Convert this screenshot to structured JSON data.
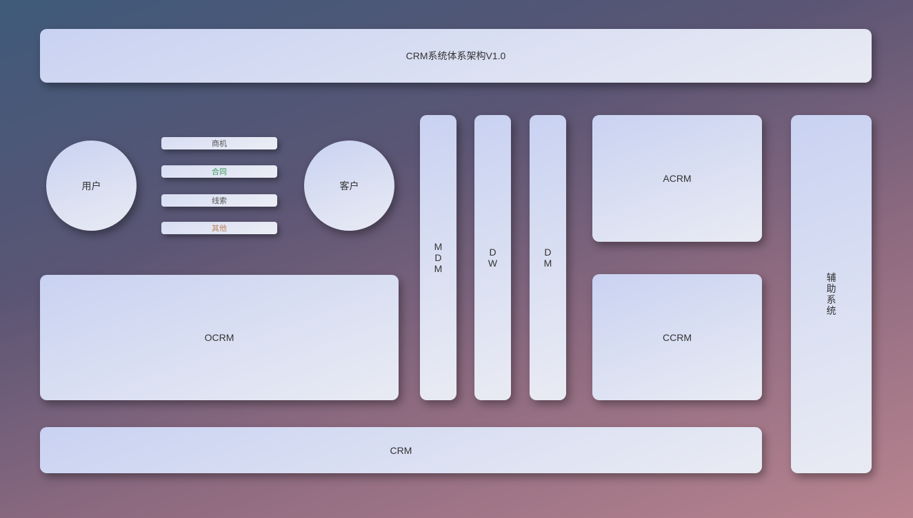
{
  "title": "CRM系统体系架构V1.0",
  "circles": {
    "user": "用户",
    "customer": "客户"
  },
  "pills": {
    "shangji": "商机",
    "hetong": "合同",
    "xiansuo": "线索",
    "qita": "其他"
  },
  "columns": {
    "mdm": "MDM",
    "dw": "DW",
    "dm": "DM"
  },
  "boxes": {
    "ocrm": "OCRM",
    "acrm": "ACRM",
    "ccrm": "CCRM",
    "crm": "CRM",
    "fuzhu": "辅助系统"
  }
}
